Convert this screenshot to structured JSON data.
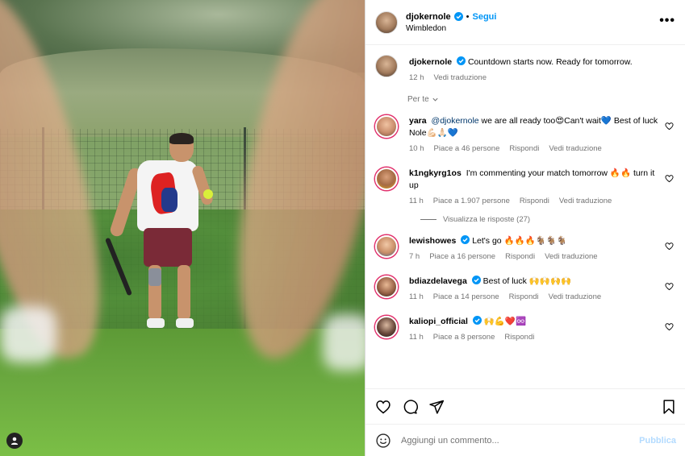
{
  "post": {
    "author": "djokernole",
    "follow_label": "Segui",
    "dot": "•",
    "location": "Wimbledon",
    "more_label": "•••"
  },
  "caption": {
    "user": "djokernole",
    "text": "Countdown starts now. Ready for tomorrow.",
    "time": "12 h",
    "translate": "Vedi traduzione"
  },
  "sort_label": "Per te",
  "comments": [
    {
      "user": "yara",
      "mention": "@djokernole",
      "text": " we are all ready too😍Can't wait💙 Best of luck Nole💪🏻🙏🏻💙",
      "time": "10 h",
      "likes": "Piace a 46 persone",
      "reply": "Rispondi",
      "translate": "Vedi traduzione"
    },
    {
      "user": "k1ngkyrg1os",
      "text": "I'm commenting your match tomorrow 🔥🔥 turn it up",
      "time": "11 h",
      "likes": "Piace a 1.907 persone",
      "reply": "Rispondi",
      "translate": "Vedi traduzione",
      "replies_label": "Visualizza le risposte (27)"
    },
    {
      "user": "lewishowes",
      "text": "Let's go 🔥🔥🔥🐐🐐🐐",
      "time": "7 h",
      "likes": "Piace a 16 persone",
      "reply": "Rispondi",
      "translate": "Vedi traduzione"
    },
    {
      "user": "bdiazdelavega",
      "text": "Best of luck 🙌🙌🙌🙌",
      "time": "11 h",
      "likes": "Piace a 14 persone",
      "reply": "Rispondi",
      "translate": "Vedi traduzione"
    },
    {
      "user": "kaliopi_official",
      "text": "🙌💪❤️♾️",
      "time": "11 h",
      "likes": "Piace a 8 persone",
      "reply": "Rispondi"
    }
  ],
  "composer": {
    "placeholder": "Aggiungi un commento...",
    "publish": "Pubblica"
  },
  "colors": {
    "link": "#0095f6",
    "verified": "#0095f6",
    "muted": "#737373",
    "mention": "#00376b"
  }
}
